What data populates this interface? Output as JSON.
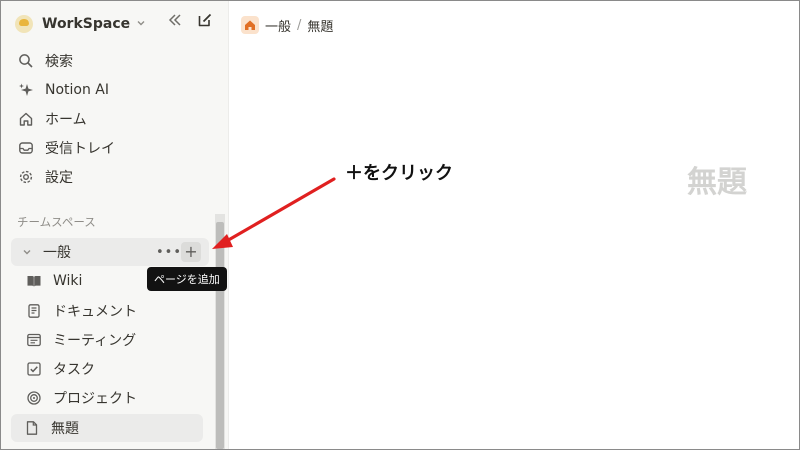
{
  "sidebar": {
    "workspace_name": "WorkSpace",
    "collapse_icon": "double-chevron-left-icon",
    "new_page_icon": "compose-icon",
    "nav": [
      {
        "label": "検索",
        "icon": "search-icon"
      },
      {
        "label": "Notion AI",
        "icon": "sparkle-icon"
      },
      {
        "label": "ホーム",
        "icon": "home-icon"
      },
      {
        "label": "受信トレイ",
        "icon": "inbox-icon"
      },
      {
        "label": "設定",
        "icon": "gear-icon"
      }
    ],
    "section_label": "チームスペース",
    "teamspace": {
      "label": "一般",
      "more_label": "•••",
      "add_label": "+"
    },
    "pages": [
      {
        "label": "Wiki",
        "icon": "book-icon"
      },
      {
        "label": "ドキュメント",
        "icon": "document-icon"
      },
      {
        "label": "ミーティング",
        "icon": "meeting-notes-icon"
      },
      {
        "label": "タスク",
        "icon": "checkbox-icon"
      },
      {
        "label": "プロジェクト",
        "icon": "target-icon"
      },
      {
        "label": "無題",
        "icon": "page-icon"
      }
    ],
    "tooltip": "ページを追加"
  },
  "breadcrumb": {
    "parent": "一般",
    "separator": "/",
    "current": "無題"
  },
  "main": {
    "page_title": "無題"
  },
  "annotation": {
    "text": "＋をクリック",
    "arrow_color": "#e02020"
  }
}
